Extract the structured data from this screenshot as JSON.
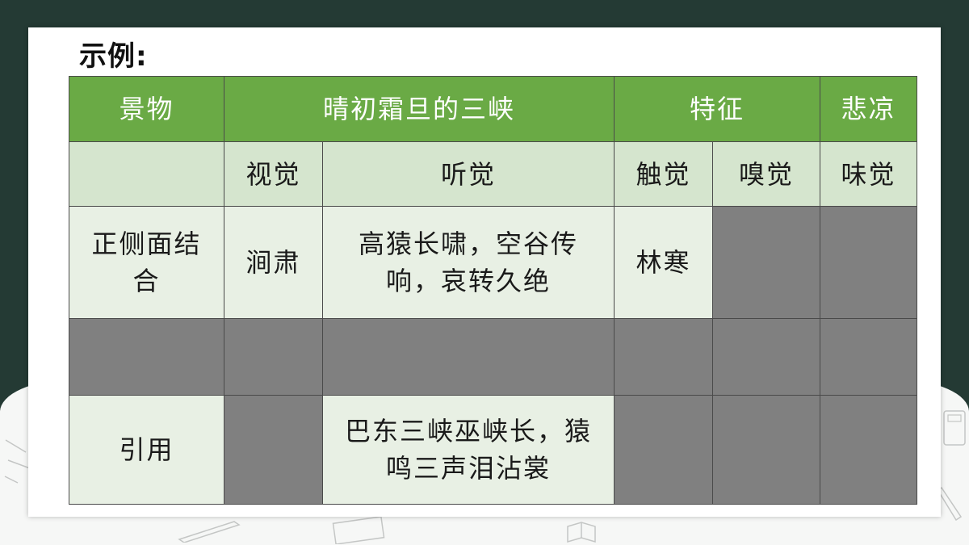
{
  "slide": {
    "heading": "示例:",
    "colors": {
      "header_green": "#6aaa45",
      "subheader_green": "#d5e5ce",
      "cell_light": "#e8f0e4",
      "cell_gray": "#808080",
      "frame_dark": "#243a34"
    }
  },
  "table": {
    "header": {
      "c1": "景物",
      "c2": "晴初霜旦的三峡",
      "c3": "特征",
      "c4": "悲凉"
    },
    "senses": {
      "c1": "",
      "sight": "视觉",
      "hearing": "听觉",
      "touch": "触觉",
      "smell": "嗅觉",
      "taste": "味觉"
    },
    "row_method": {
      "label": "正侧面结合",
      "sight": "涧肃",
      "hearing": "高猿长啸，空谷传响，哀转久绝",
      "touch": "林寒"
    },
    "row_quote": {
      "label": "引用",
      "hearing": "巴东三峡巫峡长，猿鸣三声泪沾裳"
    }
  }
}
